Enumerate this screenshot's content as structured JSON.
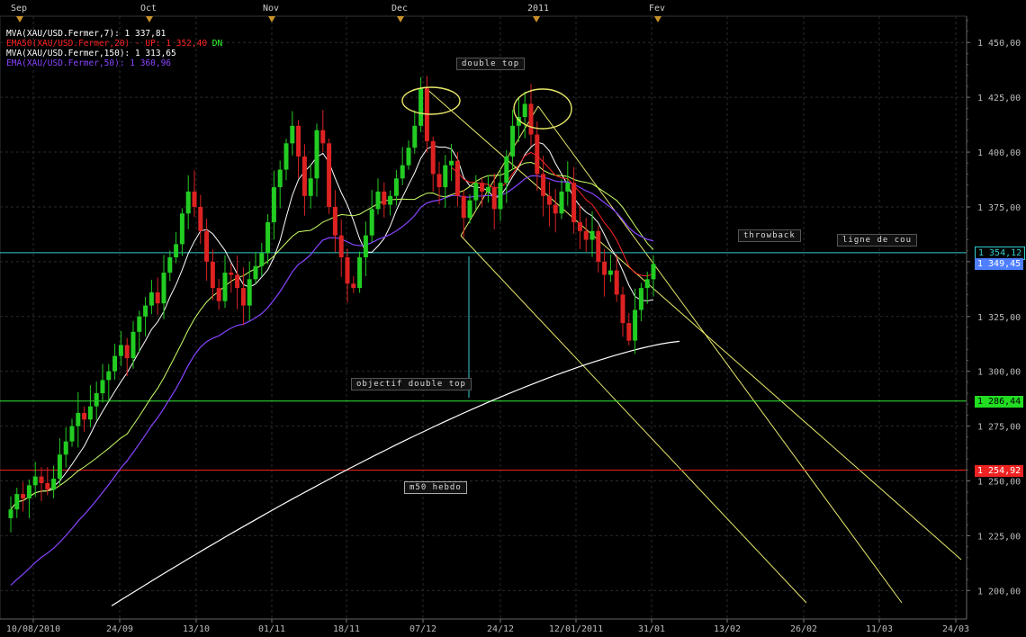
{
  "chart_data": {
    "type": "candlestick",
    "instrument": "XAU/USD",
    "ylim": [
      1187,
      1462
    ],
    "y_ticks": [
      1200,
      1225,
      1250,
      1275,
      1300,
      1325,
      1350,
      1375,
      1400,
      1425,
      1450
    ],
    "y_tick_labels": [
      "1 200,00",
      "1 225,00",
      "1 250,00",
      "1 275,00",
      "1 300,00",
      "1 325,00",
      "1 350,00",
      "1 375,00",
      "1 400,00",
      "1 425,00",
      "1 450,00"
    ],
    "x_dates": [
      "10/08/2010",
      "24/09",
      "13/10",
      "01/11",
      "18/11",
      "07/12",
      "24/12",
      "12/01/2011",
      "31/01",
      "13/02",
      "26/02",
      "11/03",
      "24/03"
    ],
    "x_markers": [
      "Sep",
      "Oct",
      "Nov",
      "Dec",
      "2011",
      "Fev"
    ],
    "legend": [
      {
        "text": "MVA(XAU/USD.Fermer,7): 1 337,81",
        "color": "#ffffff"
      },
      {
        "text": "EMA50(XAU/USD.Fermer,20) - UP: 1 352,40",
        "color": "#ff2222",
        "extra": "DN",
        "extra_color": "#33ff33"
      },
      {
        "text": "MVA(XAU/USD.Fermer,150): 1 313,65",
        "color": "#ffffff"
      },
      {
        "text": "EMA(XAU/USD.Fermer,50): 1 360,96",
        "color": "#8844ff"
      }
    ],
    "annotations": [
      "double top",
      "throwback",
      "ligne de cou",
      "objectif double top",
      "m50 hebdo"
    ],
    "horizontal_levels": [
      {
        "value": 1354.12,
        "label": "1 354,12",
        "color": "#33cccc"
      },
      {
        "value": 1349.45,
        "label": "1 349,45",
        "color": "#4f7fff"
      },
      {
        "value": 1286.44,
        "label": "1 286,44",
        "color": "#33ee33"
      },
      {
        "value": 1254.92,
        "label": "1 254,92",
        "color": "#ee2222"
      }
    ],
    "candles_close": [
      1237,
      1244,
      1242,
      1248,
      1252,
      1249,
      1246,
      1251,
      1262,
      1268,
      1275,
      1281,
      1278,
      1284,
      1290,
      1296,
      1300,
      1307,
      1312,
      1306,
      1318,
      1325,
      1330,
      1336,
      1331,
      1345,
      1352,
      1358,
      1372,
      1382,
      1375,
      1364,
      1350,
      1338,
      1332,
      1345,
      1344,
      1338,
      1330,
      1342,
      1348,
      1354,
      1368,
      1384,
      1392,
      1404,
      1412,
      1398,
      1380,
      1388,
      1410,
      1404,
      1375,
      1362,
      1352,
      1340,
      1338,
      1352,
      1362,
      1374,
      1382,
      1376,
      1380,
      1388,
      1394,
      1402,
      1412,
      1429,
      1405,
      1390,
      1384,
      1394,
      1396,
      1380,
      1370,
      1378,
      1386,
      1382,
      1384,
      1374,
      1386,
      1398,
      1412,
      1416,
      1422,
      1408,
      1390,
      1380,
      1376,
      1372,
      1382,
      1386,
      1368,
      1364,
      1360,
      1364,
      1350,
      1344,
      1346,
      1335,
      1322,
      1314,
      1328,
      1338,
      1342,
      1349
    ],
    "series": [
      {
        "name": "MVA 7",
        "color": "#ffffff"
      },
      {
        "name": "EMA50 20",
        "color": "#ff2222"
      },
      {
        "name": "MVA 150",
        "color": "#ffffff"
      },
      {
        "name": "EMA 50",
        "color": "#8844ff"
      }
    ]
  }
}
